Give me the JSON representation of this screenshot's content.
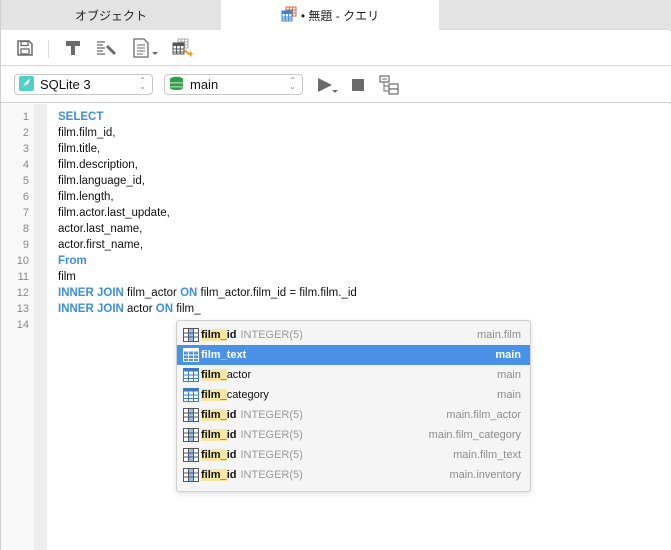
{
  "tabs": [
    {
      "label": "オブジェクト",
      "active": false
    },
    {
      "label": "• 無題 - クエリ",
      "active": true,
      "icon": "query-table-icon"
    }
  ],
  "toolbar1": {
    "buttons": [
      {
        "icon": "save-icon",
        "label": "Save"
      },
      {
        "icon": "query-builder-hammer-icon",
        "label": "Query Builder"
      },
      {
        "icon": "beautify-sql-icon",
        "label": "Beautify SQL"
      },
      {
        "icon": "code-snippet-icon",
        "label": "Snippet",
        "dropdown": true
      },
      {
        "icon": "export-result-icon",
        "label": "Export Result"
      }
    ]
  },
  "toolbar2": {
    "connection": {
      "icon": "sqlite-feather-icon",
      "value": "SQLite 3"
    },
    "database": {
      "icon": "database-icon",
      "value": "main"
    },
    "buttons": [
      {
        "icon": "run-icon",
        "label": "Run",
        "dropdown": true
      },
      {
        "icon": "stop-icon",
        "label": "Stop"
      },
      {
        "icon": "explain-icon",
        "label": "Explain"
      }
    ]
  },
  "editor": {
    "lines": [
      {
        "n": "1",
        "tokens": [
          {
            "t": "SELECT",
            "kw": true
          }
        ]
      },
      {
        "n": "2",
        "tokens": [
          {
            "t": "film.film_id,"
          }
        ]
      },
      {
        "n": "3",
        "tokens": [
          {
            "t": "film.title,"
          }
        ]
      },
      {
        "n": "4",
        "tokens": [
          {
            "t": "film.description,"
          }
        ]
      },
      {
        "n": "5",
        "tokens": [
          {
            "t": "film.language_id,"
          }
        ]
      },
      {
        "n": "6",
        "tokens": [
          {
            "t": "film.length,"
          }
        ]
      },
      {
        "n": "7",
        "tokens": [
          {
            "t": "film.actor.last_update,"
          }
        ]
      },
      {
        "n": "8",
        "tokens": [
          {
            "t": "actor.last_name,"
          }
        ]
      },
      {
        "n": "9",
        "tokens": [
          {
            "t": "actor.first_name,"
          }
        ]
      },
      {
        "n": "10",
        "tokens": [
          {
            "t": "From",
            "kw": true
          }
        ]
      },
      {
        "n": "11",
        "tokens": [
          {
            "t": "film"
          }
        ]
      },
      {
        "n": "12",
        "tokens": [
          {
            "t": "INNER JOIN",
            "kw": true
          },
          {
            "t": " film_actor "
          },
          {
            "t": "ON",
            "kw": true
          },
          {
            "t": " film_actor.film_id = film.film._id"
          }
        ]
      },
      {
        "n": "13",
        "tokens": [
          {
            "t": "INNER JOIN",
            "kw": true
          },
          {
            "t": " actor "
          },
          {
            "t": "ON",
            "kw": true
          },
          {
            "t": " film_"
          }
        ]
      },
      {
        "n": "14",
        "tokens": []
      }
    ]
  },
  "autocomplete": {
    "items": [
      {
        "kind": "column",
        "match": "film_",
        "rest": "id",
        "type": "INTEGER(5)",
        "source": "main.film",
        "selected": false
      },
      {
        "kind": "table",
        "match": "film_",
        "rest": "text",
        "type": "",
        "source": "main",
        "selected": true
      },
      {
        "kind": "table",
        "match": "film_",
        "rest": "actor",
        "type": "",
        "source": "main",
        "selected": false
      },
      {
        "kind": "table",
        "match": "film_",
        "rest": "category",
        "type": "",
        "source": "main",
        "selected": false
      },
      {
        "kind": "column",
        "match": "film_",
        "rest": "id",
        "type": "INTEGER(5)",
        "source": "main.film_actor",
        "selected": false
      },
      {
        "kind": "column",
        "match": "film_",
        "rest": "id",
        "type": "INTEGER(5)",
        "source": "main.film_category",
        "selected": false
      },
      {
        "kind": "column",
        "match": "film_",
        "rest": "id",
        "type": "INTEGER(5)",
        "source": "main.film_text",
        "selected": false
      },
      {
        "kind": "column",
        "match": "film_",
        "rest": "id",
        "type": "INTEGER(5)",
        "source": "main.inventory",
        "selected": false
      }
    ]
  },
  "colors": {
    "keyword": "#3d8ee5",
    "selection": "#4a92e8",
    "match_highlight": "#f6e8a4",
    "database_icon": "#2ea043",
    "sqlite_icon": "#4fd1c5"
  }
}
